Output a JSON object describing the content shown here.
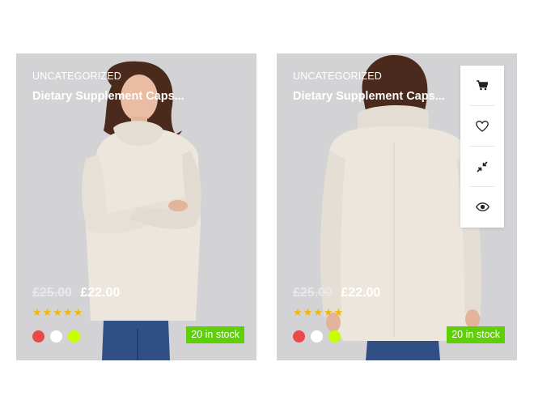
{
  "products": [
    {
      "category": "UNCATEGORIZED",
      "title": "Dietary Supplement Caps...",
      "old_price": "£25.00",
      "price": "£22.00",
      "rating": 5,
      "swatches": [
        "#e8494a",
        "#ffffff",
        "#c6ff00"
      ],
      "stock": "20 in stock"
    },
    {
      "category": "UNCATEGORIZED",
      "title": "Dietary Supplement Caps...",
      "old_price": "£25.00",
      "price": "£22.00",
      "rating": 5,
      "swatches": [
        "#e8494a",
        "#ffffff",
        "#c6ff00"
      ],
      "stock": "20 in stock"
    }
  ],
  "actions": [
    {
      "icon": "cart-icon"
    },
    {
      "icon": "heart-icon"
    },
    {
      "icon": "compare-icon"
    },
    {
      "icon": "eye-icon"
    }
  ],
  "colors": {
    "stock_badge": "#5fcf07",
    "star": "#f5b800",
    "card_bg": "#d3d3d5"
  }
}
